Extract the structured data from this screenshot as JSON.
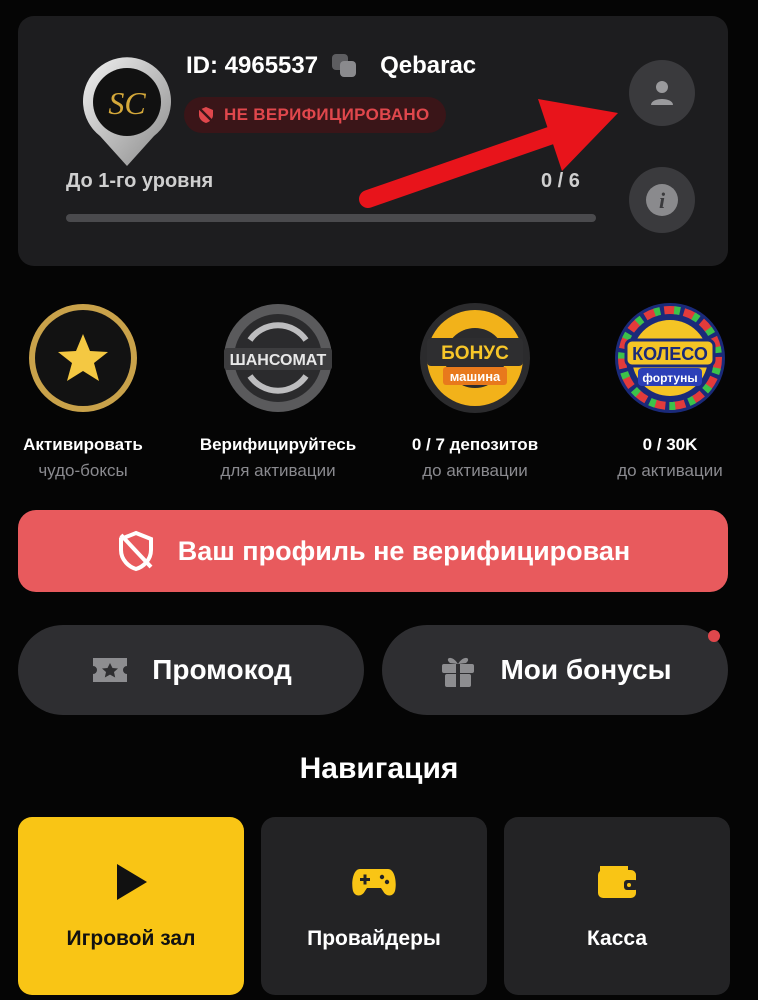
{
  "profile": {
    "id_label": "ID: 4965537",
    "nickname": "Qebarac",
    "verification_status": "НЕ ВЕРИФИЦИРОВАНО",
    "logo_text": "SC",
    "level_label": "До 1-го уровня",
    "level_progress": "0 / 6",
    "level_progress_fraction": 0,
    "profile_button_icon": "user-icon",
    "info_button_icon": "info-icon",
    "info_glyph": "i"
  },
  "features": [
    {
      "title": "Активировать",
      "sub": "чудо-боксы",
      "icon": "star-box-icon"
    },
    {
      "title": "Верифицируйтесь",
      "sub": "для активации",
      "icon": "wheel-icon",
      "badge": "ШАНСОМАТ"
    },
    {
      "title": "0 / 7 депозитов",
      "sub": "до активации",
      "icon": "bonus-machine-icon",
      "badge_top": "БОНУС",
      "badge_bottom": "машина"
    },
    {
      "title": "0 / 30K",
      "sub": "до активации",
      "icon": "fortune-wheel-icon",
      "badge_top": "КОЛЕСО",
      "badge_bottom": "фортуны"
    }
  ],
  "warning": {
    "text": "Ваш профиль не верифицирован",
    "icon": "shield-off-icon"
  },
  "actions": {
    "promo": {
      "label": "Промокод",
      "icon": "ticket-icon"
    },
    "bonuses": {
      "label": "Мои бонусы",
      "icon": "gift-icon"
    }
  },
  "navigation": {
    "heading": "Навигация",
    "tiles": [
      {
        "label": "Игровой зал",
        "icon": "play-icon",
        "active": true
      },
      {
        "label": "Провайдеры",
        "icon": "gamepad-icon",
        "active": false
      },
      {
        "label": "Касса",
        "icon": "wallet-icon",
        "active": false
      }
    ]
  },
  "colors": {
    "background": "#050505",
    "card": "#1d1d1f",
    "accent_yellow": "#f9c515",
    "danger": "#e85a5d",
    "annotation_arrow": "#e8141b"
  }
}
